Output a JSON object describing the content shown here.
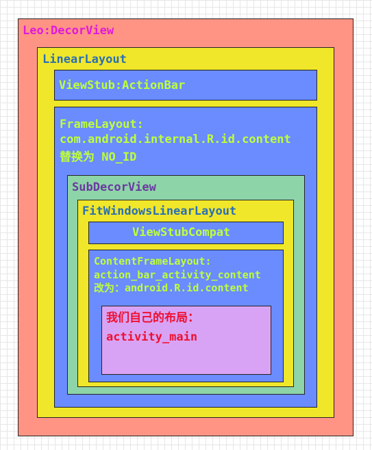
{
  "decor_view": {
    "label": "Leo:DecorView"
  },
  "linear_layout": {
    "label": "LinearLayout"
  },
  "view_stub_action_bar": {
    "label": "ViewStub:ActionBar"
  },
  "frame_layout": {
    "line1": "FrameLayout:",
    "line2": "com.android.internal.R.id.content",
    "line3": "替换为 NO_ID"
  },
  "sub_decor_view": {
    "label": "SubDecorView"
  },
  "fit_windows_linear_layout": {
    "label": "FitWindowsLinearLayout"
  },
  "view_stub_compat": {
    "label": "ViewStubCompat"
  },
  "content_frame_layout": {
    "line1": "ContentFrameLayout:",
    "line2": "action_bar_activity_content",
    "line3": "改为：android.R.id.content"
  },
  "our_layout": {
    "line1": "我们自己的布局：",
    "line2": "activity_main"
  },
  "colors": {
    "decor_view": "#ff9485",
    "linear_layout": "#f0e72a",
    "blue_box": "#6a8cff",
    "sub_decor_view": "#8dd4a8",
    "our_layout": "#d9a3f5",
    "label_magenta": "#e01ad8",
    "label_blue": "#2b6fb3",
    "label_green": "#bfff3a",
    "label_purple": "#6a3aa0",
    "label_red": "#ee1030"
  }
}
